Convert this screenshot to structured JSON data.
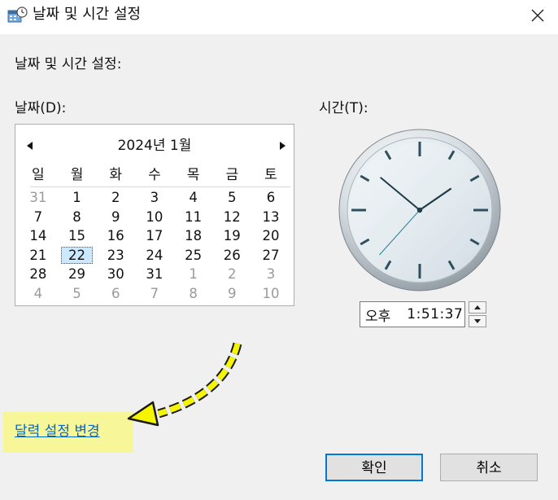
{
  "window": {
    "title": "날짜 및 시간 설정",
    "close_glyph": "✕",
    "icon": "datetime-settings-icon"
  },
  "labels": {
    "heading": "날짜 및 시간 설정:",
    "date": "날짜(D):",
    "time": "시간(T):"
  },
  "calendar": {
    "month_title": "2024년 1월",
    "prev_glyph": "◀",
    "next_glyph": "▶",
    "weekdays": [
      "일",
      "월",
      "화",
      "수",
      "목",
      "금",
      "토"
    ],
    "selected_day": "22",
    "weeks": [
      [
        {
          "d": "31",
          "other": true
        },
        {
          "d": "1"
        },
        {
          "d": "2"
        },
        {
          "d": "3"
        },
        {
          "d": "4"
        },
        {
          "d": "5"
        },
        {
          "d": "6"
        }
      ],
      [
        {
          "d": "7"
        },
        {
          "d": "8"
        },
        {
          "d": "9"
        },
        {
          "d": "10"
        },
        {
          "d": "11"
        },
        {
          "d": "12"
        },
        {
          "d": "13"
        }
      ],
      [
        {
          "d": "14"
        },
        {
          "d": "15"
        },
        {
          "d": "16"
        },
        {
          "d": "17"
        },
        {
          "d": "18"
        },
        {
          "d": "19"
        },
        {
          "d": "20"
        }
      ],
      [
        {
          "d": "21"
        },
        {
          "d": "22",
          "selected": true
        },
        {
          "d": "23"
        },
        {
          "d": "24"
        },
        {
          "d": "25"
        },
        {
          "d": "26"
        },
        {
          "d": "27"
        }
      ],
      [
        {
          "d": "28"
        },
        {
          "d": "29"
        },
        {
          "d": "30"
        },
        {
          "d": "31"
        },
        {
          "d": "1",
          "other": true
        },
        {
          "d": "2",
          "other": true
        },
        {
          "d": "3",
          "other": true
        }
      ],
      [
        {
          "d": "4",
          "other": true
        },
        {
          "d": "5",
          "other": true
        },
        {
          "d": "6",
          "other": true
        },
        {
          "d": "7",
          "other": true
        },
        {
          "d": "8",
          "other": true
        },
        {
          "d": "9",
          "other": true
        },
        {
          "d": "10",
          "other": true
        }
      ]
    ]
  },
  "clock": {
    "hour": 1,
    "minute": 51,
    "second": 37
  },
  "time_input": {
    "ampm": "오후",
    "time": "1:51:37"
  },
  "link": {
    "label": "달력 설정 변경"
  },
  "buttons": {
    "ok": "확인",
    "cancel": "취소"
  },
  "colors": {
    "link": "#0066cc",
    "highlight": "#f7f79a",
    "arrow": "#f5f500",
    "selected_day_bg": "#cce8ff",
    "ok_border": "#0078d7"
  }
}
